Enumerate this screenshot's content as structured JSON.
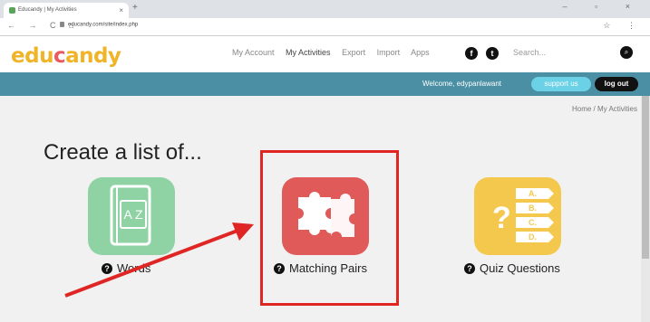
{
  "browser": {
    "tab_title": "Educandy | My Activities",
    "tab_close": "×",
    "new_tab": "+",
    "window_controls": "– ▫ ×",
    "nav_buttons": "← → C ⌂",
    "url": "educandy.com/site/index.php",
    "icons": "☆ ⋮"
  },
  "site": {
    "logo_parts": [
      "edu",
      "c",
      "andy"
    ],
    "nav": [
      "My Account",
      "My Activities",
      "Export",
      "Import",
      "Apps"
    ],
    "social": [
      "f",
      "t"
    ],
    "search_placeholder": "Search...",
    "search_icon": "⌕",
    "welcome": "Welcome, edypanlawant",
    "support_label": "support us",
    "logout_label": "log out",
    "breadcrumb": "Home / My Activities"
  },
  "main": {
    "title": "Create a list of...",
    "options": [
      {
        "label": "Words",
        "icon": "book-az-icon",
        "color": "#8fd3a4",
        "glyph": "A Z"
      },
      {
        "label": "Matching Pairs",
        "icon": "puzzle-icon",
        "color": "#e05a5a"
      },
      {
        "label": "Quiz Questions",
        "icon": "quiz-abcd-icon",
        "color": "#f3c84c",
        "choices": [
          "A.",
          "B.",
          "C.",
          "D."
        ],
        "mark": "?"
      }
    ],
    "help_glyph": "?"
  }
}
